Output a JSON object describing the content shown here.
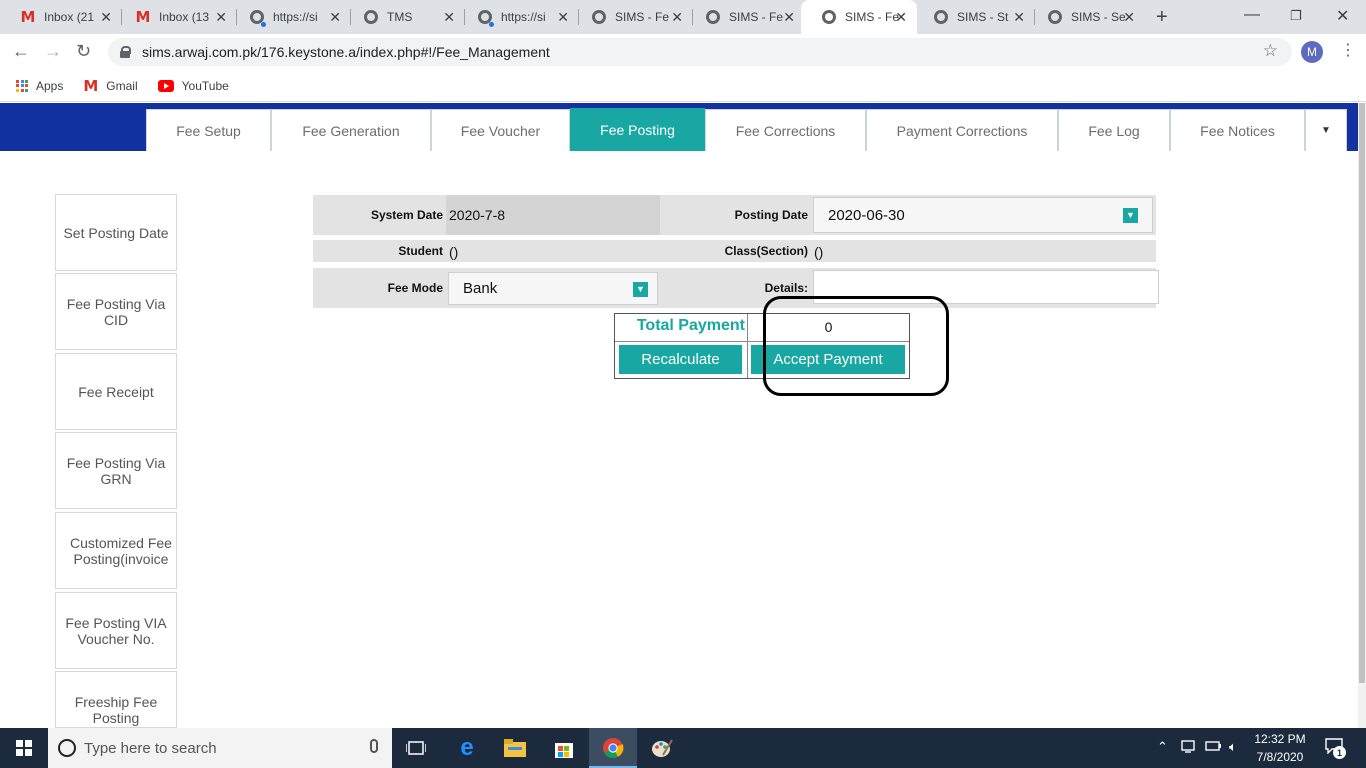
{
  "browser": {
    "tabs": [
      {
        "title": "Inbox (21",
        "icon": "gmail-icon"
      },
      {
        "title": "Inbox (13",
        "icon": "gmail-icon"
      },
      {
        "title": "https://si",
        "icon": "globe-icon",
        "loading": true
      },
      {
        "title": "TMS",
        "icon": "globe-icon"
      },
      {
        "title": "https://si",
        "icon": "globe-icon",
        "loading": true
      },
      {
        "title": "SIMS - Fe",
        "icon": "globe-icon"
      },
      {
        "title": "SIMS - Fe",
        "icon": "globe-icon"
      },
      {
        "title": "SIMS - Fe",
        "icon": "globe-icon",
        "active": true
      },
      {
        "title": "SIMS - St",
        "icon": "globe-icon"
      },
      {
        "title": "SIMS - Se",
        "icon": "globe-icon"
      }
    ],
    "new_tab": "+",
    "url": "sims.arwaj.com.pk/176.keystone.a/index.php#!/Fee_Management",
    "profile_initial": "M",
    "bookmarks": [
      {
        "label": "Apps",
        "icon": "apps-grid-icon"
      },
      {
        "label": "Gmail",
        "icon": "gmail-icon"
      },
      {
        "label": "YouTube",
        "icon": "youtube-icon"
      }
    ]
  },
  "nav_tabs": [
    {
      "label": "Fee Setup"
    },
    {
      "label": "Fee Generation"
    },
    {
      "label": "Fee Voucher"
    },
    {
      "label": "Fee Posting",
      "active": true
    },
    {
      "label": "Fee Corrections"
    },
    {
      "label": "Payment Corrections"
    },
    {
      "label": "Fee Log"
    },
    {
      "label": "Fee Notices"
    }
  ],
  "sidebar": {
    "items": [
      {
        "label": "Set Posting Date"
      },
      {
        "label": "Fee Posting Via CID"
      },
      {
        "label": "Fee Receipt"
      },
      {
        "label": "Fee Posting Via GRN"
      },
      {
        "label": "Customized Fee Posting(invoice"
      },
      {
        "label": "Fee Posting VIA Voucher No."
      },
      {
        "label": "Freeship Fee Posting"
      }
    ]
  },
  "form": {
    "system_date_label": "System Date",
    "system_date_value": "2020-7-8",
    "posting_date_label": "Posting Date",
    "posting_date_value": "2020-06-30",
    "student_label": "Student",
    "student_value": "()",
    "class_label": "Class(Section)",
    "class_value": "()",
    "fee_mode_label": "Fee Mode",
    "fee_mode_value": "Bank",
    "details_label": "Details:",
    "details_value": ""
  },
  "payment": {
    "total_label": "Total Payment",
    "total_value": "0",
    "recalculate_label": "Recalculate",
    "accept_label": "Accept Payment"
  },
  "taskbar": {
    "search_placeholder": "Type here to search",
    "time": "12:32 PM",
    "date": "7/8/2020",
    "notification_count": "1"
  },
  "colors": {
    "accent": "#18a7a2",
    "header_band": "#12329f"
  }
}
